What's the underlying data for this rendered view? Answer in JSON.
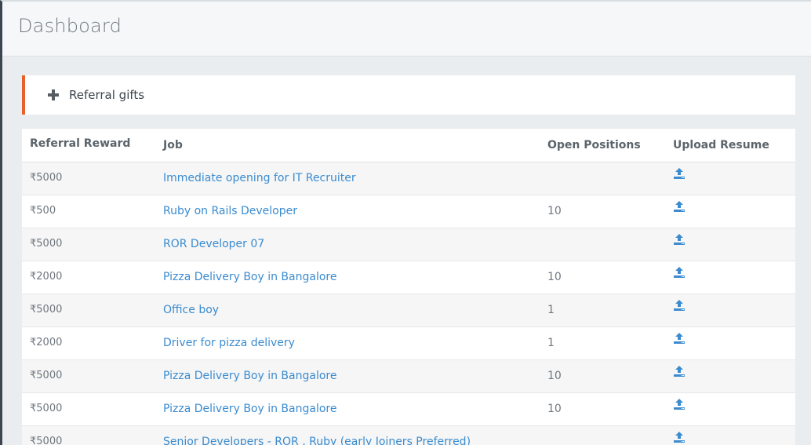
{
  "header": {
    "title": "Dashboard"
  },
  "referral_panel": {
    "label": "Referral gifts",
    "accent_color": "#e8602c"
  },
  "table": {
    "columns": [
      "Referral Reward",
      "Job",
      "Open Positions",
      "Upload Resume"
    ],
    "rows": [
      {
        "reward": "₹5000",
        "job": "Immediate opening for IT Recruiter",
        "open": ""
      },
      {
        "reward": "₹500",
        "job": "Ruby on Rails Developer",
        "open": "10"
      },
      {
        "reward": "₹5000",
        "job": "ROR Developer 07",
        "open": ""
      },
      {
        "reward": "₹2000",
        "job": "Pizza Delivery Boy in Bangalore",
        "open": "10"
      },
      {
        "reward": "₹5000",
        "job": "Office boy",
        "open": "1"
      },
      {
        "reward": "₹2000",
        "job": "Driver for pizza delivery",
        "open": "1"
      },
      {
        "reward": "₹5000",
        "job": "Pizza Delivery Boy in Bangalore",
        "open": "10"
      },
      {
        "reward": "₹5000",
        "job": "Pizza Delivery Boy in Bangalore",
        "open": "10"
      },
      {
        "reward": "₹5000",
        "job": "Senior Developers - ROR , Ruby (early Joiners Preferred)",
        "open": ""
      }
    ]
  },
  "icons": {
    "upload": "upload-icon",
    "plus": "plus-icon"
  },
  "colors": {
    "link": "#3a8bcf",
    "accent": "#e8602c"
  }
}
